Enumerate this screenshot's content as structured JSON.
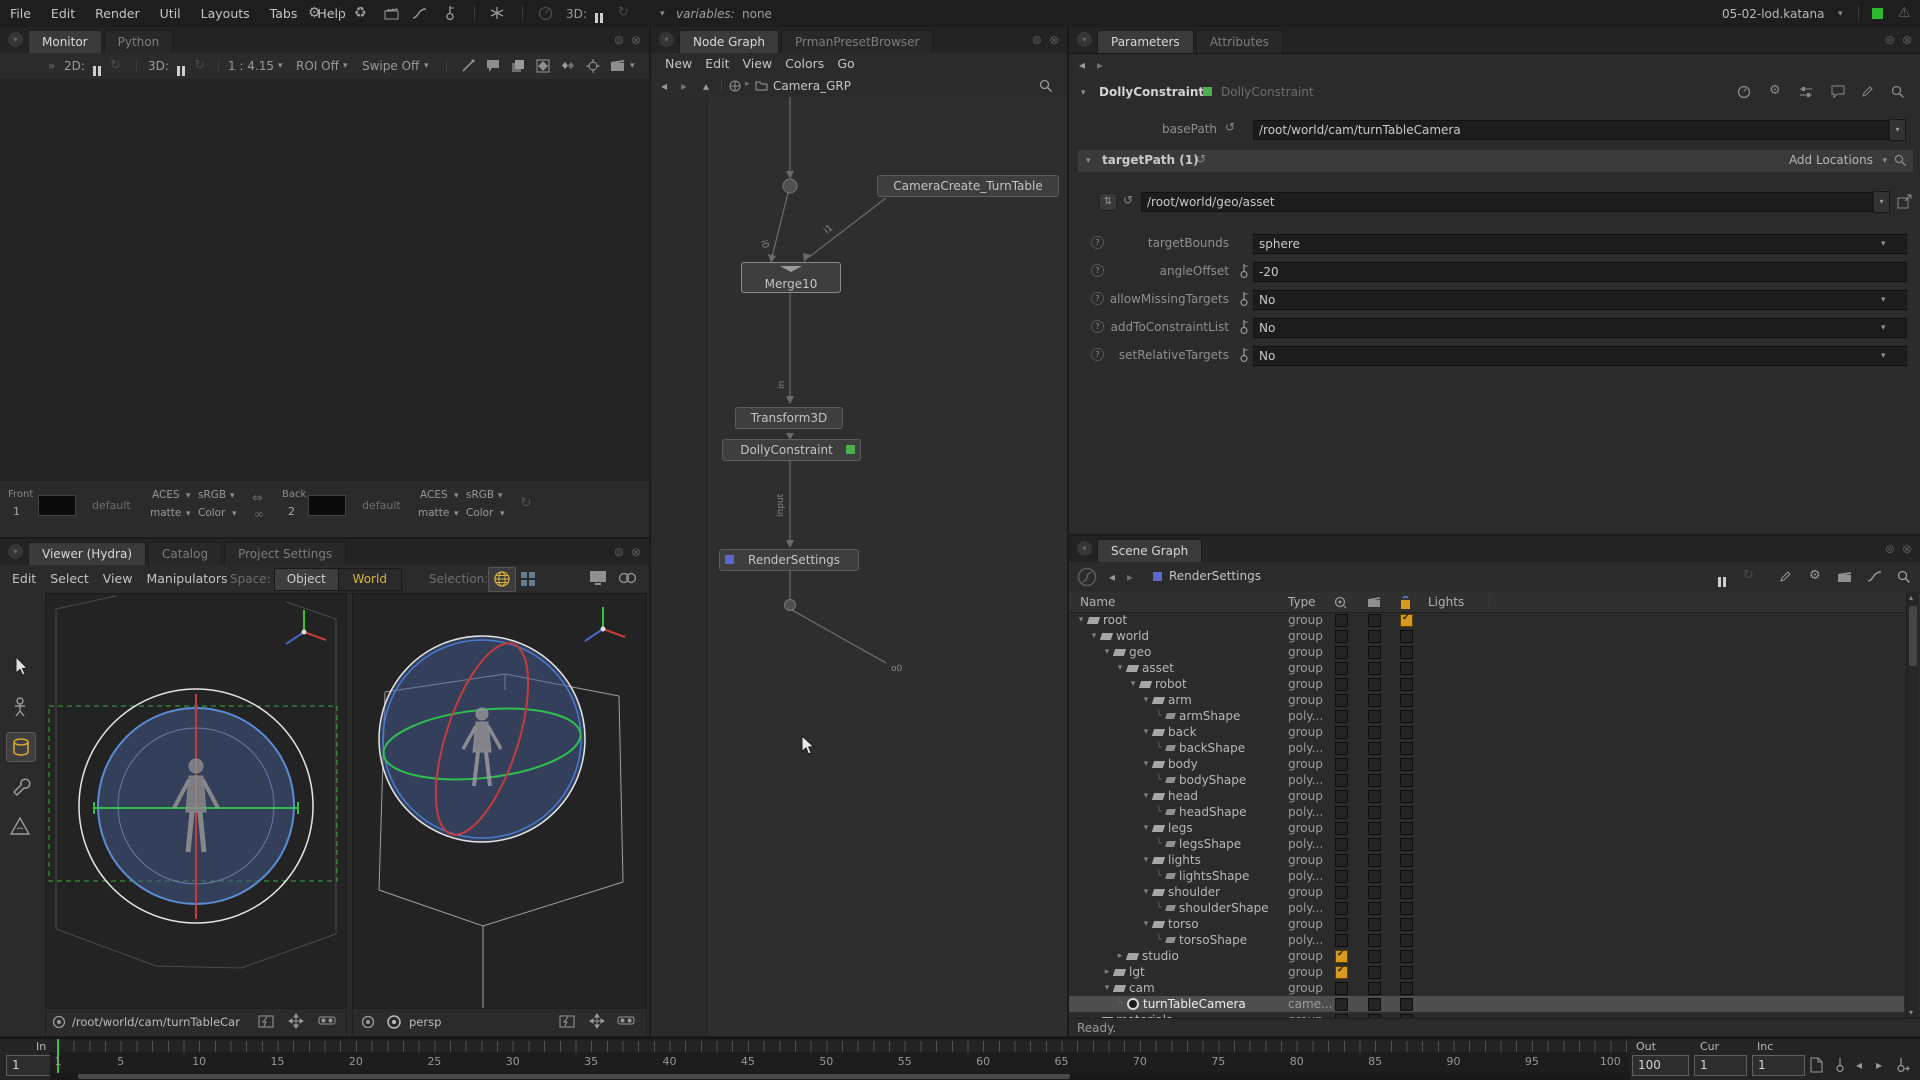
{
  "window": {
    "title": "05-02-lod.katana"
  },
  "menubar": {
    "items": [
      "File",
      "Edit",
      "Render",
      "Util",
      "Layouts",
      "Tabs",
      "Help"
    ],
    "threed_label": "3D:",
    "variables_label": "variables:",
    "variables_value": "none"
  },
  "monitor": {
    "tabs": [
      "Monitor",
      "Python"
    ],
    "toolbar": {
      "twod": "2D:",
      "threed": "3D:",
      "ratio": "1 : 4.15",
      "roi": "ROI Off",
      "swipe": "Swipe Off"
    },
    "footer": {
      "front_label": "Front",
      "front_num": "1",
      "back_label": "Back",
      "back_num": "2",
      "default_label": "default",
      "aces": "ACES",
      "srgb": "sRGB",
      "matte": "matte",
      "color": "Color"
    }
  },
  "viewer": {
    "tabs": [
      "Viewer (Hydra)",
      "Catalog",
      "Project Settings"
    ],
    "menus": [
      "Edit",
      "Select",
      "View",
      "Manipulators"
    ],
    "space_label": "Space:",
    "space_object": "Object",
    "space_world": "World",
    "selection_label": "Selection:",
    "left_camera_path": "/root/world/cam/turnTableCar",
    "right_camera_name": "persp"
  },
  "nodegraph": {
    "tabs": [
      "Node Graph",
      "PrmanPresetBrowser"
    ],
    "menus": [
      "New",
      "Edit",
      "View",
      "Colors",
      "Go"
    ],
    "breadcrumb": "Camera_GRP",
    "nodes": {
      "camera_create": "CameraCreate_TurnTable",
      "merge": "Merge10",
      "transform": "Transform3D",
      "dolly": "DollyConstraint",
      "render_settings": "RenderSettings"
    },
    "port_labels": {
      "i0": "i0",
      "i1": "i1",
      "in": "in",
      "input": "input",
      "o0": "o0"
    }
  },
  "parameters": {
    "tabs": [
      "Parameters",
      "Attributes"
    ],
    "node_name": "DollyConstraint",
    "node_type": "DollyConstraint",
    "base_path_label": "basePath",
    "base_path_value": "/root/world/cam/turnTableCamera",
    "target_path_label": "targetPath (1)",
    "add_locations_label": "Add Locations",
    "target_value": "/root/world/geo/asset",
    "rows": [
      {
        "label": "targetBounds",
        "value": "sphere",
        "has_key": false,
        "has_dropdown": true
      },
      {
        "label": "angleOffset",
        "value": "-20",
        "has_key": true,
        "has_dropdown": false
      },
      {
        "label": "allowMissingTargets",
        "value": "No",
        "has_key": true,
        "has_dropdown": true
      },
      {
        "label": "addToConstraintList",
        "value": "No",
        "has_key": true,
        "has_dropdown": true
      },
      {
        "label": "setRelativeTargets",
        "value": "No",
        "has_key": true,
        "has_dropdown": true
      }
    ]
  },
  "scenegraph": {
    "tab": "Scene Graph",
    "current_node": "RenderSettings",
    "columns": {
      "name": "Name",
      "type": "Type",
      "lights": "Lights"
    },
    "status": "Ready.",
    "rows": [
      {
        "name": "root",
        "type": "group",
        "level": 0,
        "marker": "open",
        "icon": "group",
        "c3": "on"
      },
      {
        "name": "world",
        "type": "group",
        "level": 1,
        "marker": "open",
        "icon": "group"
      },
      {
        "name": "geo",
        "type": "group",
        "level": 2,
        "marker": "open",
        "icon": "group"
      },
      {
        "name": "asset",
        "type": "group",
        "level": 3,
        "marker": "open",
        "icon": "group"
      },
      {
        "name": "robot",
        "type": "group",
        "level": 4,
        "marker": "open",
        "icon": "group"
      },
      {
        "name": "arm",
        "type": "group",
        "level": 5,
        "marker": "open",
        "icon": "group"
      },
      {
        "name": "armShape",
        "type": "poly...",
        "level": 6,
        "marker": "leaf",
        "icon": "poly"
      },
      {
        "name": "back",
        "type": "group",
        "level": 5,
        "marker": "open",
        "icon": "group"
      },
      {
        "name": "backShape",
        "type": "poly...",
        "level": 6,
        "marker": "leaf",
        "icon": "poly"
      },
      {
        "name": "body",
        "type": "group",
        "level": 5,
        "marker": "open",
        "icon": "group"
      },
      {
        "name": "bodyShape",
        "type": "poly...",
        "level": 6,
        "marker": "leaf",
        "icon": "poly"
      },
      {
        "name": "head",
        "type": "group",
        "level": 5,
        "marker": "open",
        "icon": "group"
      },
      {
        "name": "headShape",
        "type": "poly...",
        "level": 6,
        "marker": "leaf",
        "icon": "poly"
      },
      {
        "name": "legs",
        "type": "group",
        "level": 5,
        "marker": "open",
        "icon": "group"
      },
      {
        "name": "legsShape",
        "type": "poly...",
        "level": 6,
        "marker": "leaf",
        "icon": "poly"
      },
      {
        "name": "lights",
        "type": "group",
        "level": 5,
        "marker": "open",
        "icon": "group"
      },
      {
        "name": "lightsShape",
        "type": "poly...",
        "level": 6,
        "marker": "leaf",
        "icon": "poly"
      },
      {
        "name": "shoulder",
        "type": "group",
        "level": 5,
        "marker": "open",
        "icon": "group"
      },
      {
        "name": "shoulderShape",
        "type": "poly...",
        "level": 6,
        "marker": "leaf",
        "icon": "poly"
      },
      {
        "name": "torso",
        "type": "group",
        "level": 5,
        "marker": "open",
        "icon": "group"
      },
      {
        "name": "torsoShape",
        "type": "poly...",
        "level": 6,
        "marker": "leaf",
        "icon": "poly"
      },
      {
        "name": "studio",
        "type": "group",
        "level": 3,
        "marker": "closed",
        "icon": "group",
        "c1": "on"
      },
      {
        "name": "lgt",
        "type": "group",
        "level": 2,
        "marker": "closed",
        "icon": "group",
        "c1": "on"
      },
      {
        "name": "cam",
        "type": "group",
        "level": 2,
        "marker": "open",
        "icon": "group"
      },
      {
        "name": "turnTableCamera",
        "type": "came...",
        "level": 3,
        "marker": "leaf",
        "icon": "camera",
        "selected": true
      },
      {
        "name": "materials",
        "type": "group",
        "level": 1,
        "marker": "closed",
        "icon": "group"
      }
    ]
  },
  "timeline": {
    "in_label": "In",
    "in_value": "1",
    "out_label": "Out",
    "out_value": "100",
    "cur_label": "Cur",
    "cur_value": "1",
    "inc_label": "Inc",
    "inc_value": "1",
    "ticks": [
      1,
      5,
      10,
      15,
      20,
      25,
      30,
      35,
      40,
      45,
      50,
      55,
      60,
      65,
      70,
      75,
      80,
      85,
      90,
      95,
      100
    ]
  }
}
